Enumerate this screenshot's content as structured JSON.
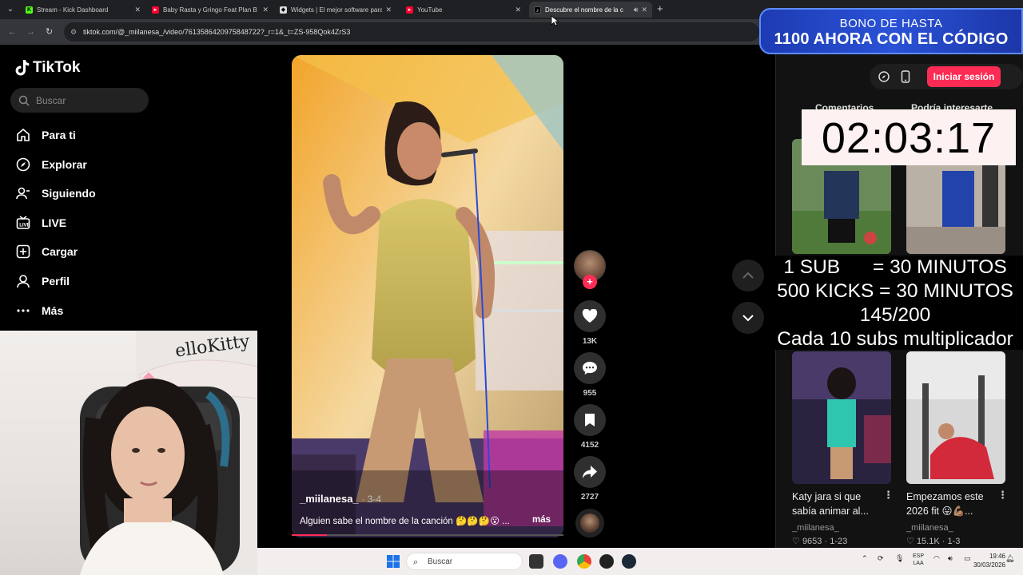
{
  "browser": {
    "tabs": [
      {
        "title": "Stream - Kick Dashboard",
        "favicon": "kick-icon",
        "color": "#53fc18",
        "active": false
      },
      {
        "title": "Baby Rasta y Gringo Feat Plan B",
        "favicon": "youtube-icon",
        "color": "#ff0033",
        "active": false
      },
      {
        "title": "Widgets | El mejor software para",
        "favicon": "widgets-icon",
        "color": "#dddddd",
        "active": false
      },
      {
        "title": "YouTube",
        "favicon": "youtube-icon",
        "color": "#ff0033",
        "active": false
      },
      {
        "title": "Descubre el nombre de la c",
        "favicon": "tiktok-icon",
        "color": "#ffffff",
        "active": true
      }
    ],
    "new_tab": "+",
    "url": "tiktok.com/@_miilanesa_/video/7613586420975848722?_r=1&_t=ZS-958Qok4ZrS3"
  },
  "tiktok": {
    "logo_text": "TikTok",
    "search_placeholder": "Buscar",
    "nav": [
      {
        "label": "Para ti",
        "icon": "home-icon"
      },
      {
        "label": "Explorar",
        "icon": "compass-icon"
      },
      {
        "label": "Siguiendo",
        "icon": "following-icon"
      },
      {
        "label": "LIVE",
        "icon": "live-icon"
      },
      {
        "label": "Cargar",
        "icon": "upload-icon"
      },
      {
        "label": "Perfil",
        "icon": "profile-icon"
      },
      {
        "label": "Más",
        "icon": "more-icon"
      }
    ],
    "video": {
      "author": "_miilanesa_",
      "date": "3-4",
      "caption": "Alguien sabe el nombre de la canción 🤔🤔🤔😮 ...",
      "more": "más",
      "progress": 0.13
    },
    "actions": {
      "likes": "13K",
      "comments": "955",
      "saves": "4152",
      "shares": "2727"
    },
    "login_button": "Iniciar sesión",
    "right_tabs": [
      "Comentarios",
      "Podría interesarte"
    ],
    "suggestions": [
      {
        "title": "Katy jara si que sabía animar al...",
        "author": "_miilanesa_",
        "likes": "9653",
        "date": "1-23"
      },
      {
        "title": "Empezamos este 2026 fit 😛💪🏽...",
        "author": "_miilanesa_",
        "likes": "15.1K",
        "date": "1-3"
      }
    ]
  },
  "overlays": {
    "banner_line1": "BONO DE HASTA",
    "banner_line2": "1100 AHORA CON EL CÓDIGO",
    "timer": "02:03:17",
    "sub_lines": [
      "1 SUB      = 30 MINUTOS",
      "500 KICKS = 30 MINUTOS",
      "145/200",
      "Cada 10 subs multiplicador"
    ]
  },
  "taskbar": {
    "search_placeholder": "Buscar",
    "lang_top": "ESP",
    "lang_bottom": "LAA",
    "time": "19:46",
    "date": "30/03/2026"
  },
  "colors": {
    "accent": "#fe2c55",
    "banner": "#2a52d6"
  }
}
